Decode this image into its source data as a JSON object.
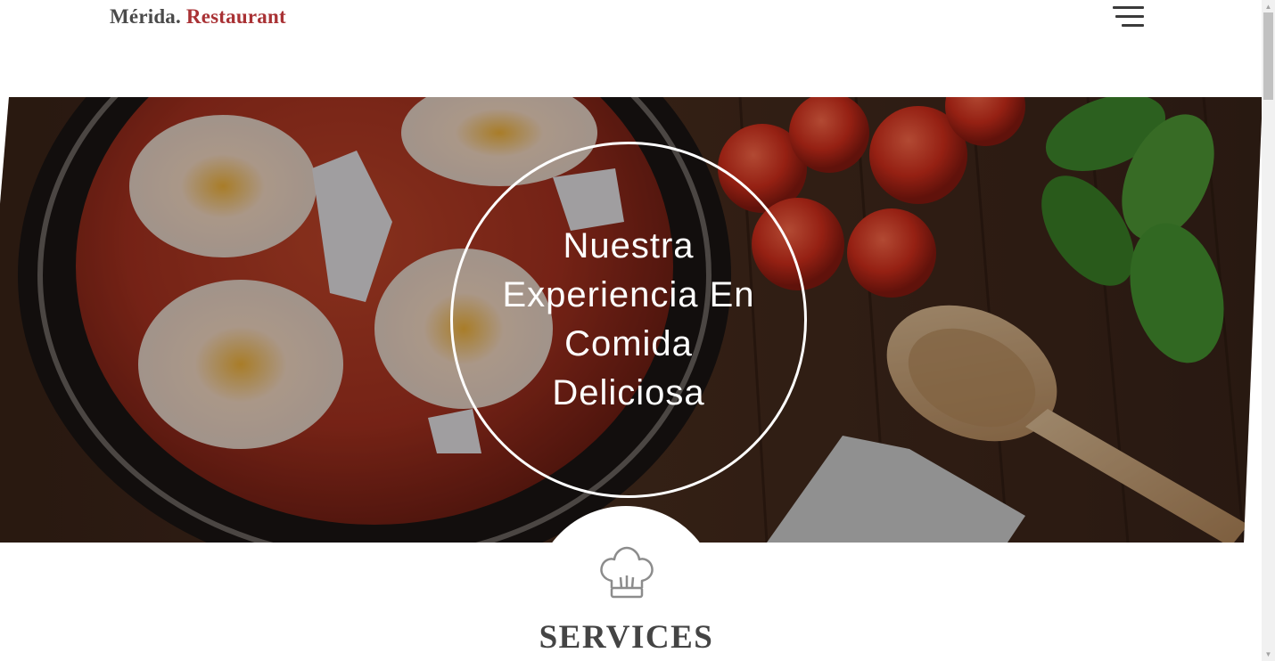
{
  "header": {
    "brand_name": "Mérida.",
    "brand_accent": "Restaurant",
    "menu_icon": "hamburger-menu-icon"
  },
  "hero": {
    "title": "Nuestra Experiencia En Comida Deliciosa"
  },
  "services": {
    "icon": "chef-hat-icon",
    "title": "SERVICES"
  },
  "colors": {
    "brand_text": "#4a4a4a",
    "accent": "#a93235",
    "heading": "#444444"
  }
}
